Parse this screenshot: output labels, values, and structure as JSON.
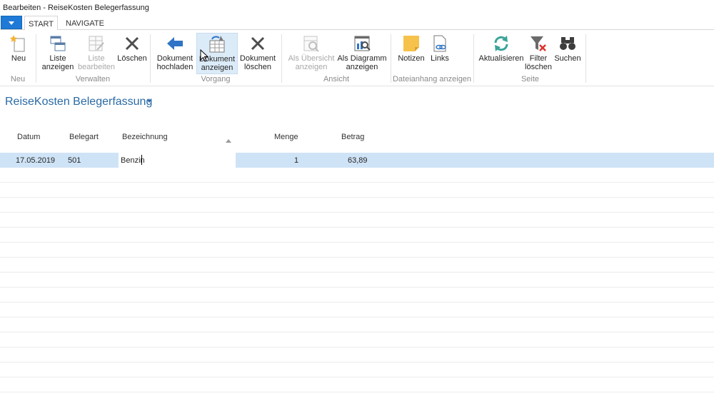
{
  "window": {
    "title": "Bearbeiten - ReiseKosten Belegerfassung"
  },
  "tabs": [
    {
      "label": "START",
      "active": true
    },
    {
      "label": "NAVIGATE",
      "active": false
    }
  ],
  "ribbon": {
    "groups": [
      {
        "label": "Neu",
        "buttons": [
          {
            "label1": "Neu",
            "label2": "",
            "icon": "new-star-icon",
            "enabled": true
          }
        ]
      },
      {
        "label": "Verwalten",
        "buttons": [
          {
            "label1": "Liste",
            "label2": "anzeigen",
            "icon": "list-view-icon",
            "enabled": true
          },
          {
            "label1": "Liste",
            "label2": "bearbeiten",
            "icon": "list-edit-icon",
            "enabled": false
          },
          {
            "label1": "Löschen",
            "label2": "",
            "icon": "delete-x-icon",
            "enabled": true
          }
        ]
      },
      {
        "label": "Vorgang",
        "buttons": [
          {
            "label1": "Dokument",
            "label2": "hochladen",
            "icon": "arrow-left-icon",
            "enabled": true
          },
          {
            "label1": "Dokument",
            "label2": "anzeigen",
            "icon": "document-show-icon",
            "enabled": true
          },
          {
            "label1": "Dokument",
            "label2": "löschen",
            "icon": "delete-x-icon",
            "enabled": true
          }
        ]
      },
      {
        "label": "Ansicht",
        "buttons": [
          {
            "label1": "Als Übersicht",
            "label2": "anzeigen",
            "icon": "overview-icon",
            "enabled": false
          },
          {
            "label1": "Als Diagramm",
            "label2": "anzeigen",
            "icon": "chart-icon",
            "enabled": true
          }
        ]
      },
      {
        "label": "Dateianhang anzeigen",
        "buttons": [
          {
            "label1": "Notizen",
            "label2": "",
            "icon": "note-icon",
            "enabled": true
          },
          {
            "label1": "Links",
            "label2": "",
            "icon": "link-icon",
            "enabled": true
          }
        ]
      },
      {
        "label": "Seite",
        "buttons": [
          {
            "label1": "Aktualisieren",
            "label2": "",
            "icon": "refresh-icon",
            "enabled": true
          },
          {
            "label1": "Filter",
            "label2": "löschen",
            "icon": "clear-filter-icon",
            "enabled": true
          },
          {
            "label1": "Suchen",
            "label2": "",
            "icon": "binoculars-icon",
            "enabled": true
          }
        ]
      }
    ]
  },
  "page": {
    "title": "ReiseKosten Belegerfassung"
  },
  "table": {
    "columns": [
      "Datum",
      "Belegart",
      "Bezeichnung",
      "Menge",
      "Betrag"
    ],
    "rows": [
      {
        "datum": "17.05.2019",
        "belegart": "501",
        "bezeichnung": "Benzin",
        "menge": "1",
        "betrag": "63,89"
      }
    ]
  },
  "colors": {
    "accent": "#1e7ad6",
    "title": "#2a6aa5",
    "selection": "#cfe3f6"
  }
}
